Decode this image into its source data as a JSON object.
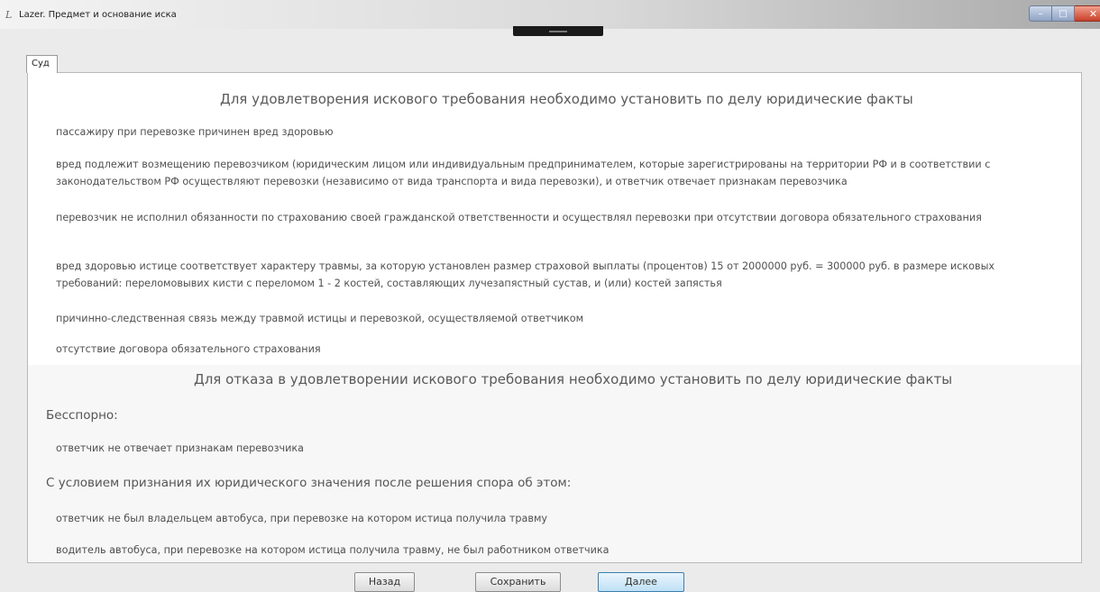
{
  "window": {
    "title": "Lazer. Предмет и основание иска",
    "controls": {
      "minimize": "–",
      "maximize": "□",
      "close": "✕"
    }
  },
  "tabs": [
    {
      "label": "Суд"
    }
  ],
  "main": {
    "heading_grant": "Для удовлетворения искового требования необходимо установить по делу юридические факты",
    "grant_facts": [
      "пассажиру при перевозке причинен вред здоровью",
      "вред подлежит возмещению перевозчиком (юридическим лицом или индивидуальным предпринимателем, которые зарегистрированы на территории РФ и в соответствии с законодательством РФ осуществляют перевозки (независимо от вида транспорта и вида перевозки), и ответчик отвечает признакам перевозчика",
      "перевозчик не исполнил обязанности по страхованию своей гражданской ответственности и осуществлял перевозки при отсутствии договора обязательного страхования",
      "вред здоровью истице соответствует характеру травмы, за которую установлен размер страховой выплаты (процентов) 15 от 2000000 руб. = 300000 руб. в размере исковых требований:  переломовывих кисти с переломом 1 - 2 костей, составляющих лучезапястный сустав, и (или) костей запястья",
      "причинно-следственная связь между травмой истицы и перевозкой, осуществляемой ответчиком",
      "отсутствие договора обязательного страхования"
    ],
    "heading_deny": "Для отказа в удовлетворении искового требования необходимо установить по делу юридические факты",
    "undisputed_label": "Бесспорно:",
    "undisputed_facts": [
      "ответчик не отвечает признакам перевозчика"
    ],
    "conditional_label": "С условием признания их юридического значения после решения спора об этом:",
    "conditional_facts": [
      "ответчик не был владельцем автобуса, при перевозке на котором истица получила травму",
      "водитель автобуса, при перевозке на котором истица получила травму, не был работником ответчика"
    ]
  },
  "footer": {
    "back_label": "Назад",
    "save_label": "Сохранить",
    "next_label": "Далее"
  }
}
